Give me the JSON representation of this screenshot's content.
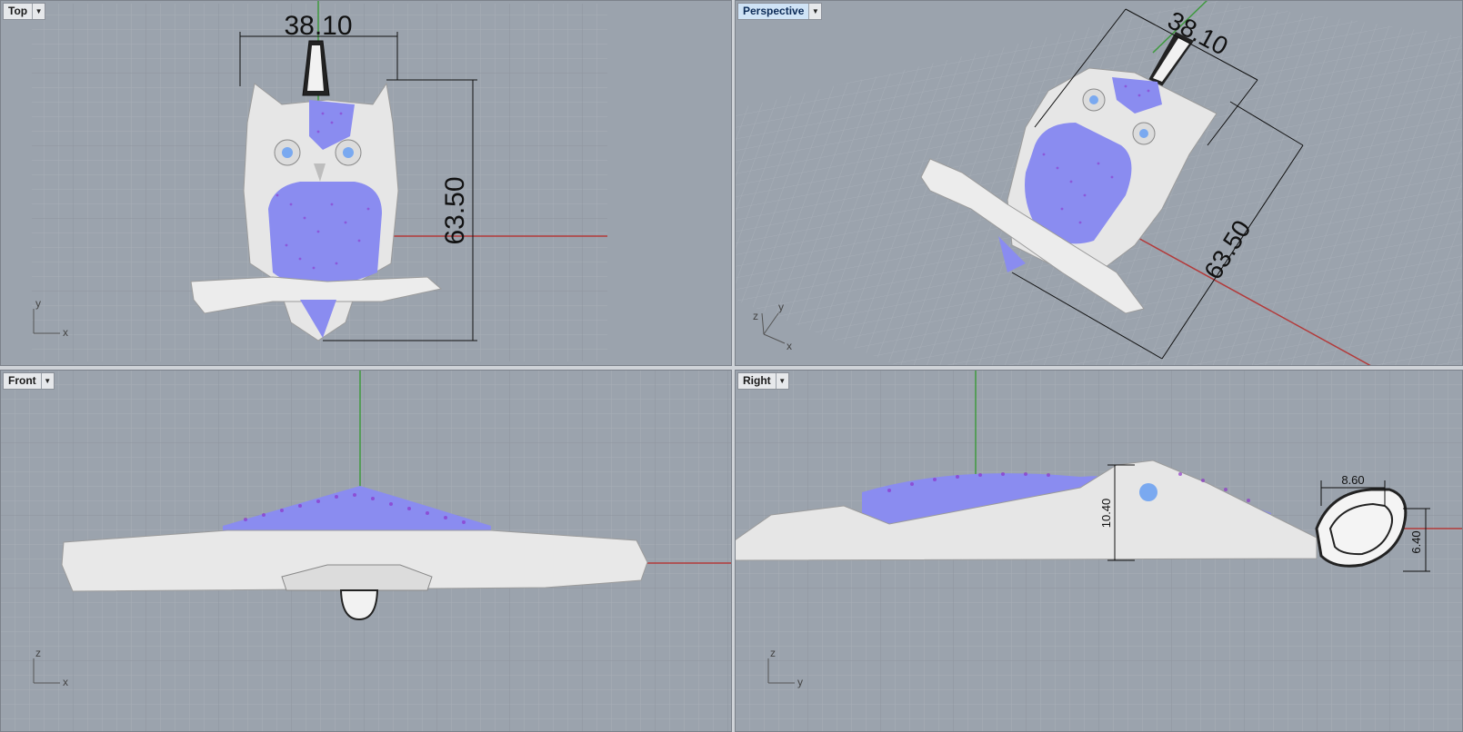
{
  "viewports": {
    "top": {
      "title": "Top",
      "dims": [
        "38.10",
        "63.50"
      ],
      "axes": [
        "y",
        "x"
      ]
    },
    "perspective": {
      "title": "Perspective",
      "dims": [
        "38.10",
        "63.50"
      ],
      "axes": [
        "z",
        "y",
        "x"
      ]
    },
    "front": {
      "title": "Front",
      "dims": [],
      "axes": [
        "z",
        "x"
      ]
    },
    "right": {
      "title": "Right",
      "dims": [
        "8.60",
        "10.40",
        "6.40"
      ],
      "axes": [
        "z",
        "y"
      ]
    }
  },
  "colors": {
    "viewport_bg": "#9ba3ad",
    "grid_minor": "#a8afb8",
    "grid_major": "#8f969f",
    "x_axis": "#b33a3a",
    "y_axis": "#3f9a3f",
    "model": "#e8e8e8",
    "gems": "#8a8cf0",
    "gem_dots": "#8d2fc9",
    "eyes": "#7aa9f0"
  }
}
